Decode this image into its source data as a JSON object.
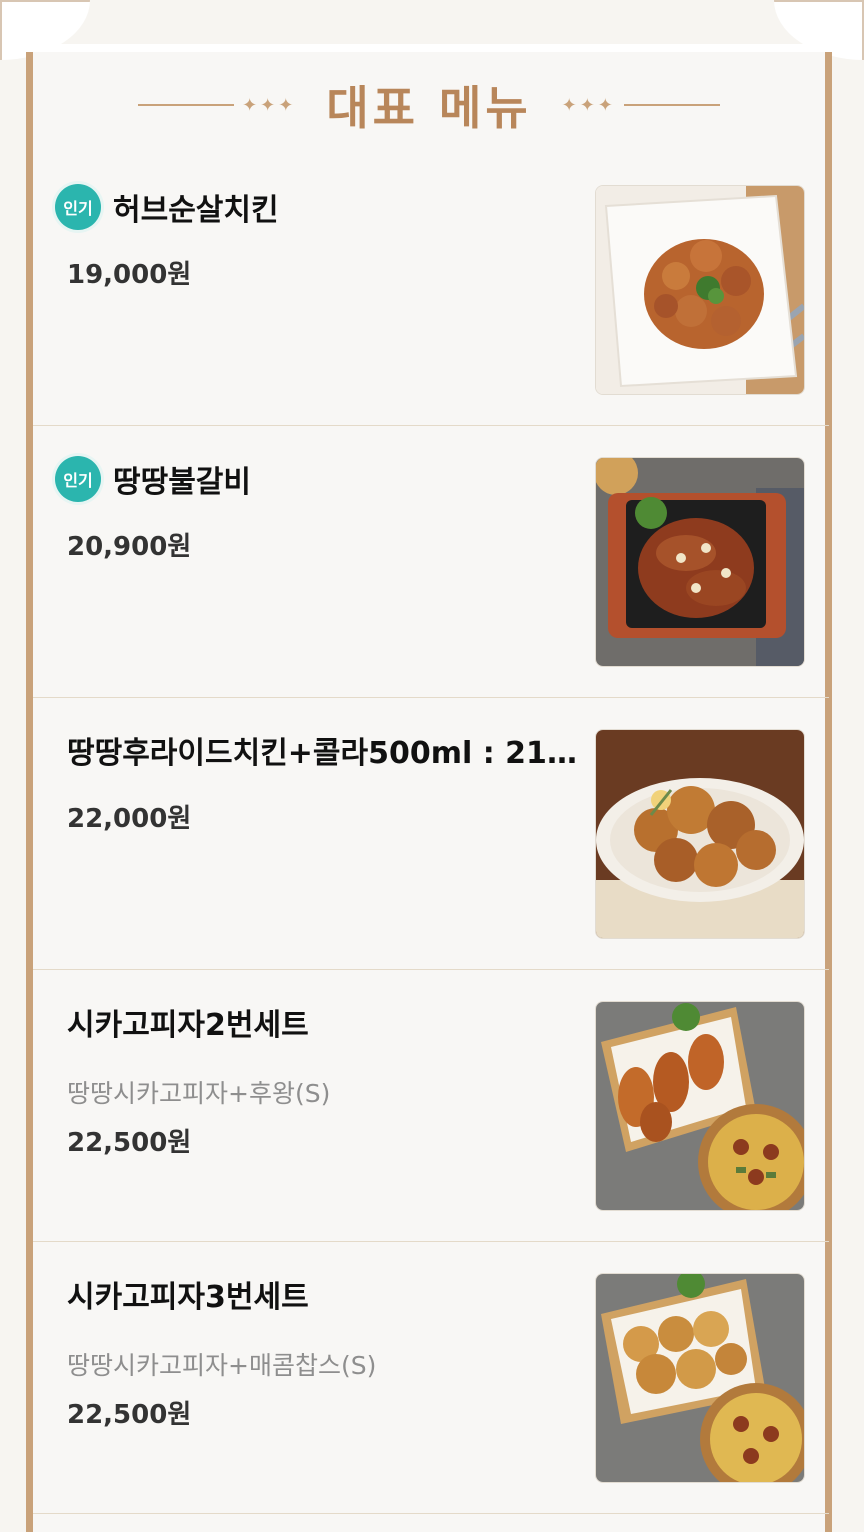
{
  "header": {
    "title": "대표 메뉴",
    "ornament": "✦✦✦"
  },
  "colors": {
    "accent": "#c9a27a",
    "title": "#b8865a",
    "badge": "#2bb5ae"
  },
  "menu": [
    {
      "name": "허브순살치킨",
      "badge": "인기",
      "desc": "",
      "price": "19,000원",
      "image_icon": "boneless-chicken-photo"
    },
    {
      "name": "땅땅불갈비",
      "badge": "인기",
      "desc": "",
      "price": "20,900원",
      "image_icon": "galbi-skillet-photo"
    },
    {
      "name": "땅땅후라이드치킨+콜라500ml : 21...",
      "badge": "",
      "desc": "",
      "price": "22,000원",
      "image_icon": "fried-chicken-plate-photo"
    },
    {
      "name": "시카고피자2번세트",
      "badge": "",
      "desc": "땅땅시카고피자+후왕(S)",
      "price": "22,500원",
      "image_icon": "chicken-pizza-set-photo"
    },
    {
      "name": "시카고피자3번세트",
      "badge": "",
      "desc": "땅땅시카고피자+매콤찹스(S)",
      "price": "22,500원",
      "image_icon": "chicken-pizza-set-photo"
    }
  ]
}
